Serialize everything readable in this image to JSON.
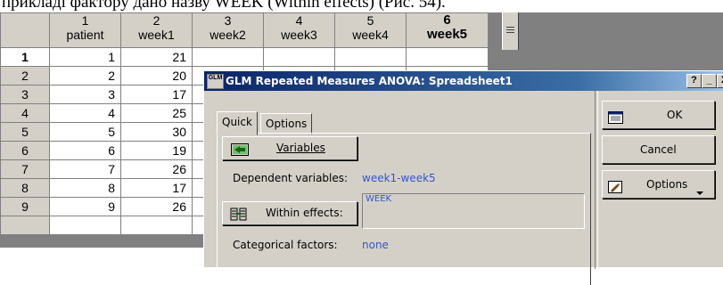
{
  "doc": {
    "text": "прикладі фактору дано назву WEEK (Within effects) (Рис. 54)."
  },
  "sheet": {
    "columns": [
      {
        "num": "1",
        "name": "patient"
      },
      {
        "num": "2",
        "name": "week1"
      },
      {
        "num": "3",
        "name": "week2"
      },
      {
        "num": "4",
        "name": "week3"
      },
      {
        "num": "5",
        "name": "week4"
      },
      {
        "num": "6",
        "name": "week5"
      }
    ],
    "rows": [
      {
        "num": "1",
        "patient": "1",
        "week1": "21"
      },
      {
        "num": "2",
        "patient": "2",
        "week1": "20"
      },
      {
        "num": "3",
        "patient": "3",
        "week1": "17"
      },
      {
        "num": "4",
        "patient": "4",
        "week1": "25"
      },
      {
        "num": "5",
        "patient": "5",
        "week1": "30"
      },
      {
        "num": "6",
        "patient": "6",
        "week1": "19"
      },
      {
        "num": "7",
        "patient": "7",
        "week1": "26"
      },
      {
        "num": "8",
        "patient": "8",
        "week1": "17"
      },
      {
        "num": "9",
        "patient": "9",
        "week1": "26"
      }
    ]
  },
  "dialog": {
    "app_icon": "GLM",
    "title": "GLM Repeated Measures ANOVA: Spreadsheet1",
    "help_btn": "?",
    "min_btn": "_",
    "close_btn": "X",
    "tabs": [
      {
        "label": "Quick"
      },
      {
        "label": "Options"
      }
    ],
    "variables_button": "Variables",
    "dependent_label": "Dependent variables:",
    "dependent_value": "week1-week5",
    "within_button": "Within effects:",
    "within_value": "WEEK",
    "categorical_label": "Categorical factors:",
    "categorical_value": "none",
    "ok_button": "OK",
    "cancel_button": "Cancel",
    "options_button": "Options"
  },
  "colors": {
    "title_start": "#0a246a",
    "title_end": "#a6caf0",
    "face": "#d4d0c8",
    "value_blue": "#3355cc"
  },
  "icons": [
    "variables-icon",
    "within-effects-icon",
    "ok-icon",
    "options-icon",
    "dropdown-arrow-icon"
  ]
}
